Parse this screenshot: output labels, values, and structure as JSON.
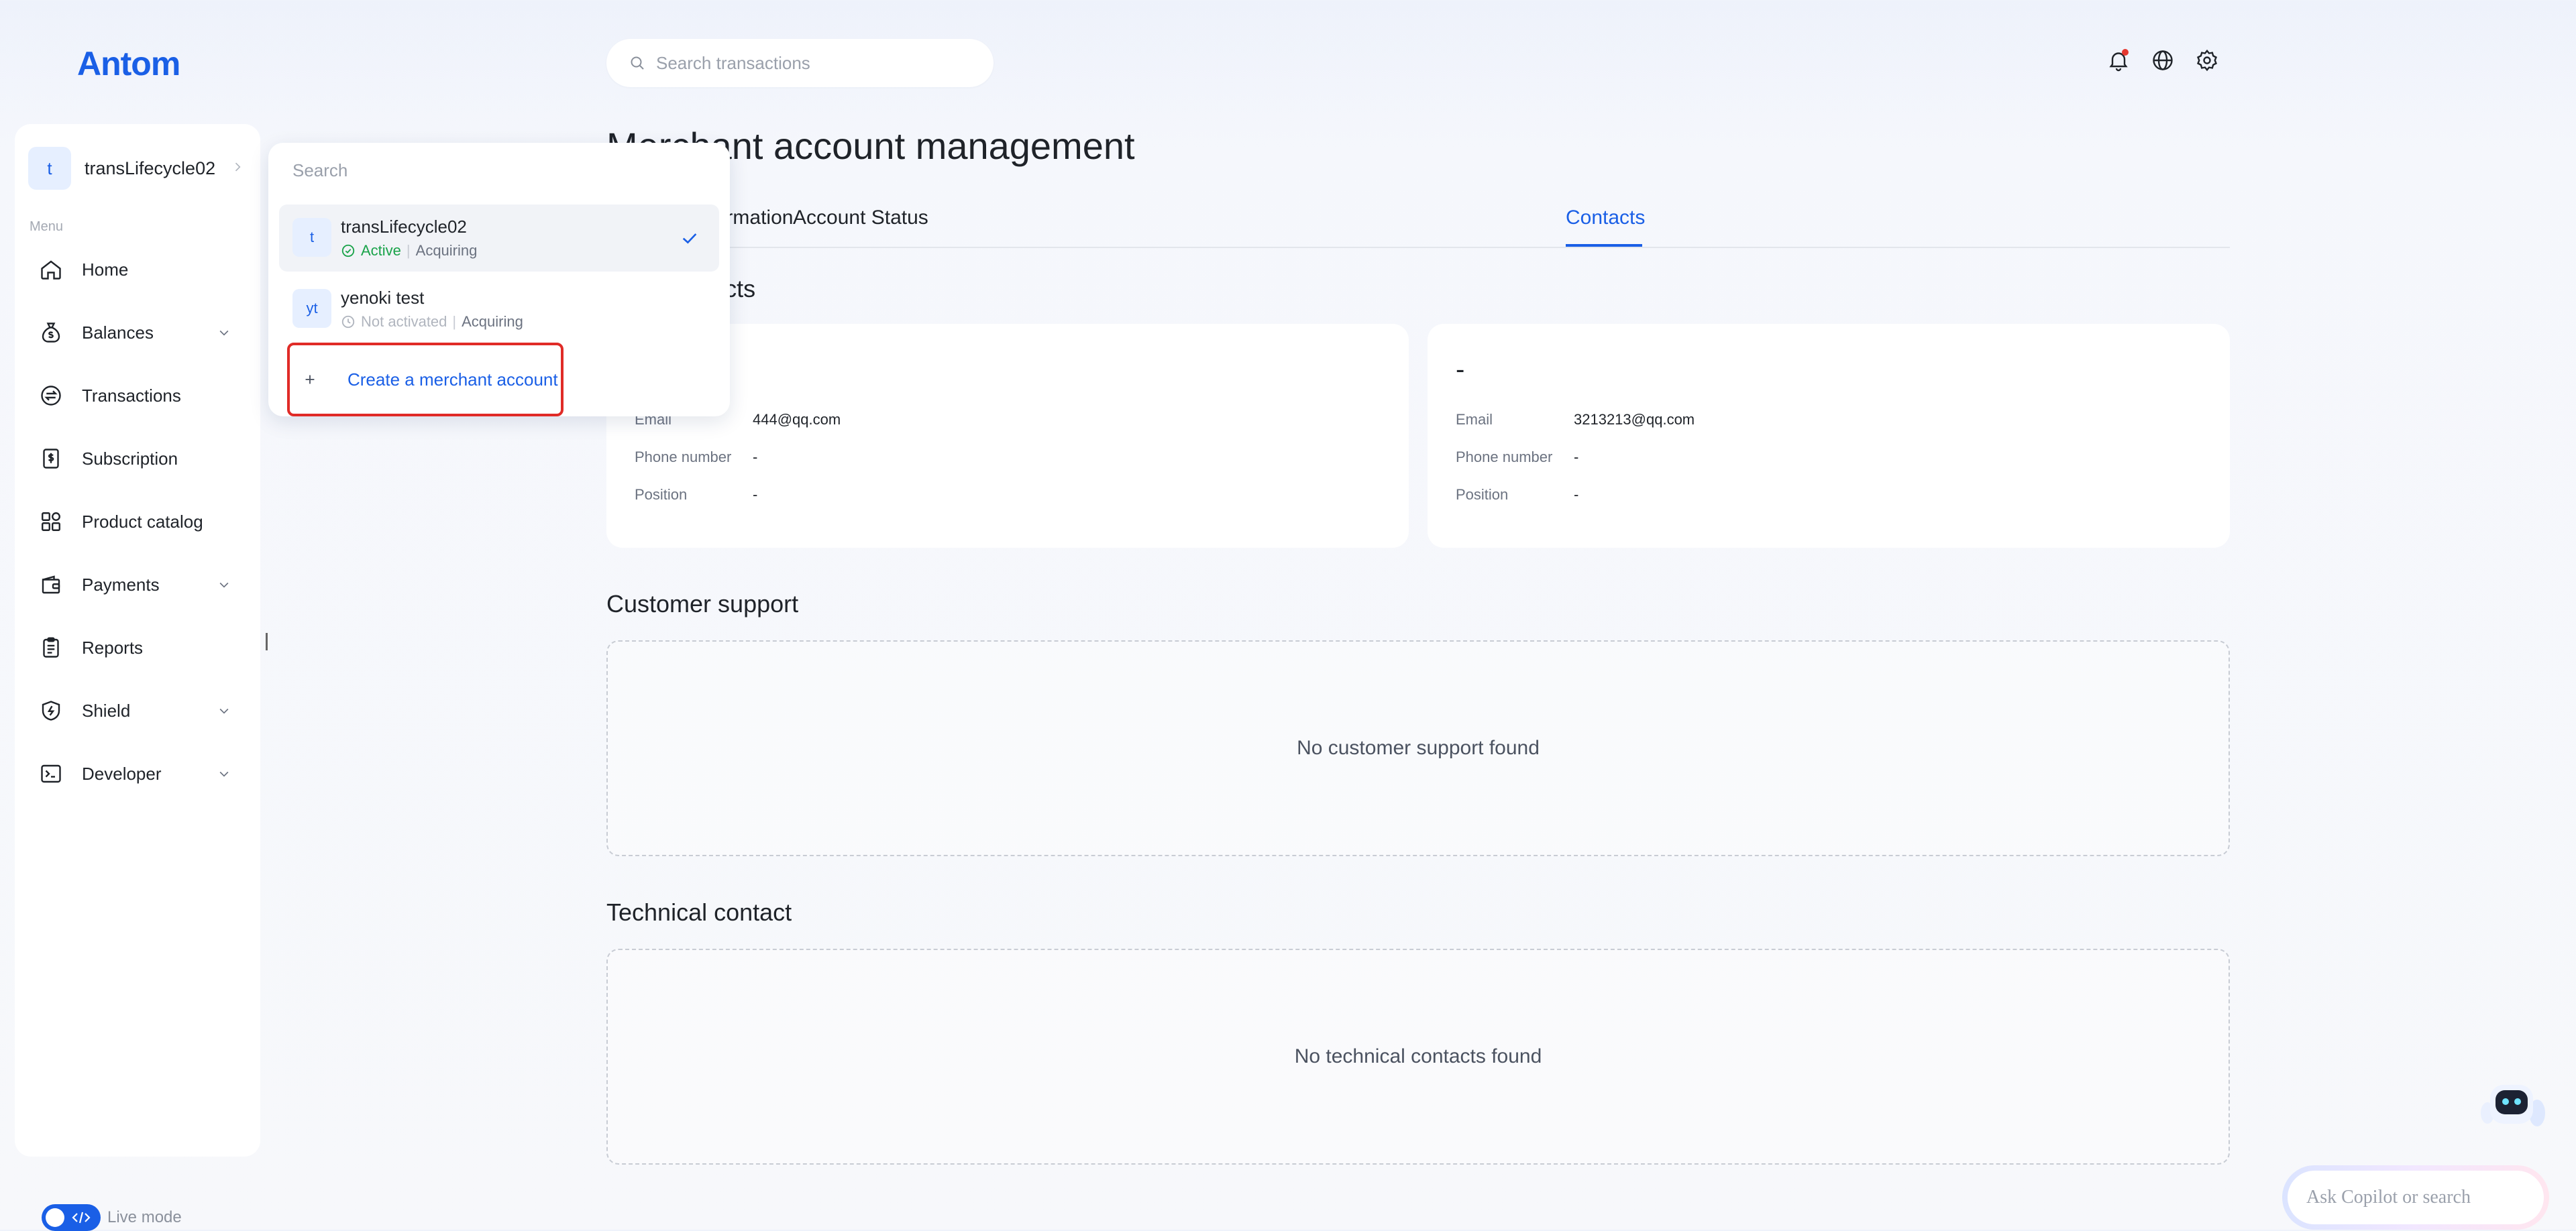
{
  "brand": {
    "logo_text": "Antom"
  },
  "header": {
    "search_placeholder": "Search transactions",
    "icons": [
      "bell-icon",
      "globe-icon",
      "gear-icon"
    ]
  },
  "sidebar": {
    "account_avatar": "t",
    "account_name": "transLifecycle02",
    "menu_label": "Menu",
    "items": [
      {
        "label": "Home",
        "icon": "home-icon",
        "has_children": false
      },
      {
        "label": "Balances",
        "icon": "money-bag-icon",
        "has_children": true
      },
      {
        "label": "Transactions",
        "icon": "exchange-icon",
        "has_children": false
      },
      {
        "label": "Subscription",
        "icon": "dollar-doc-icon",
        "has_children": false
      },
      {
        "label": "Product catalog",
        "icon": "grid-icon",
        "has_children": false
      },
      {
        "label": "Payments",
        "icon": "wallet-icon",
        "has_children": true
      },
      {
        "label": "Reports",
        "icon": "clipboard-icon",
        "has_children": false
      },
      {
        "label": "Shield",
        "icon": "shield-icon",
        "has_children": true
      },
      {
        "label": "Developer",
        "icon": "terminal-icon",
        "has_children": true
      }
    ],
    "live_mode_label": "Live mode",
    "live_mode_on": true
  },
  "main": {
    "page_title": "Merchant account management",
    "tabs": [
      {
        "label": "Business information",
        "active": false
      },
      {
        "label": "Account Status",
        "active": false
      },
      {
        "label": "Contacts",
        "active": true
      }
    ],
    "main_contacts_title": "Main contacts",
    "contacts": [
      {
        "name": "-",
        "email_label": "Email",
        "email": "444@qq.com",
        "phone_label": "Phone number",
        "phone": "-",
        "position_label": "Position",
        "position": "-"
      },
      {
        "name": "-",
        "email_label": "Email",
        "email": "3213213@qq.com",
        "phone_label": "Phone number",
        "phone": "-",
        "position_label": "Position",
        "position": "-"
      }
    ],
    "customer_support_title": "Customer support",
    "customer_support_empty": "No customer support found",
    "technical_contact_title": "Technical contact",
    "technical_contact_empty": "No technical contacts found"
  },
  "account_dropdown": {
    "search_placeholder": "Search",
    "accounts": [
      {
        "avatar": "t",
        "name": "transLifecycle02",
        "status": "Active",
        "type": "Acquiring",
        "selected": true
      },
      {
        "avatar": "yt",
        "name": "yenoki test",
        "status": "Not activated",
        "type": "Acquiring",
        "selected": false
      }
    ],
    "separator": "|",
    "create_label": "Create a merchant account"
  },
  "copilot": {
    "placeholder": "Ask Copilot or search"
  },
  "colors": {
    "accent": "#1a5fe6",
    "active": "#1aa34a",
    "highlight_border": "#e02b27"
  }
}
